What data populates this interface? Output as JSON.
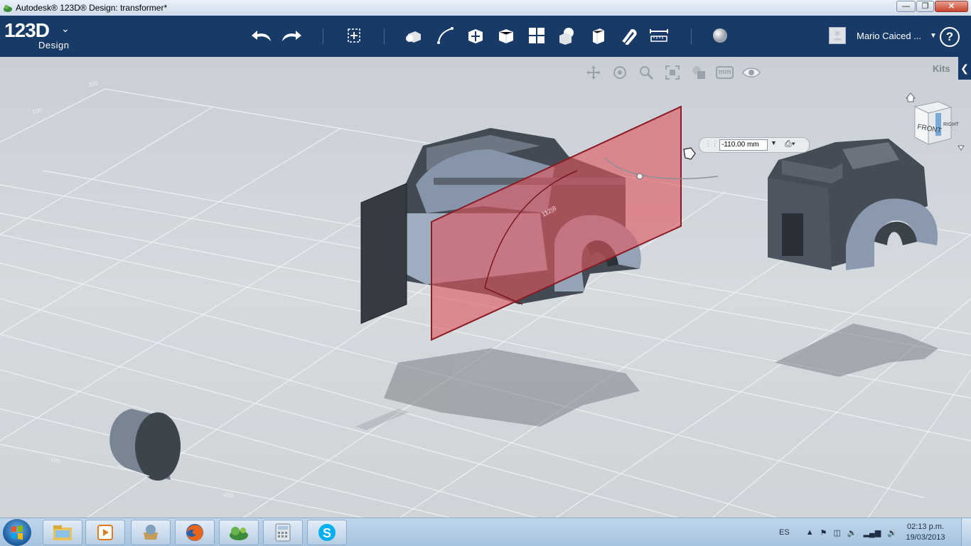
{
  "window": {
    "title": "Autodesk® 123D® Design: transformer*",
    "controls": [
      "minimize-icon",
      "restore-icon",
      "close-icon"
    ]
  },
  "app": {
    "logo_main": "123D",
    "logo_sub": "Design",
    "toolbar": [
      "undo-icon",
      "redo-icon",
      "transform-icon",
      "primitives-icon",
      "sketch-icon",
      "construct-icon",
      "modify-icon",
      "pattern-icon",
      "grouping-icon",
      "combine-icon",
      "snap-icon",
      "measure-icon",
      "material-icon"
    ],
    "user": "Mario Caiced ...",
    "help": "?"
  },
  "viewport": {
    "nav": [
      "pan-icon",
      "orbit-icon",
      "zoom-icon",
      "fit-icon",
      "materials-outlines-icon",
      "mm",
      "visibility-icon"
    ],
    "kits_label": "Kits",
    "viewcube_face": "FRONT",
    "viewcube_side": "RIGHT",
    "dimension_value": "-110.00 mm",
    "plane_label": "112|8",
    "grid_labels": [
      "-200",
      "-100",
      "100",
      "200"
    ],
    "accent": "#e05560"
  },
  "taskbar": {
    "apps": [
      "windows-explorer-icon",
      "media-player-icon",
      "app-icon",
      "firefox-icon",
      "123d-icon",
      "calculator-icon",
      "skype-icon"
    ],
    "lang": "ES",
    "time": "02:13 p.m.",
    "date": "19/03/2013"
  }
}
